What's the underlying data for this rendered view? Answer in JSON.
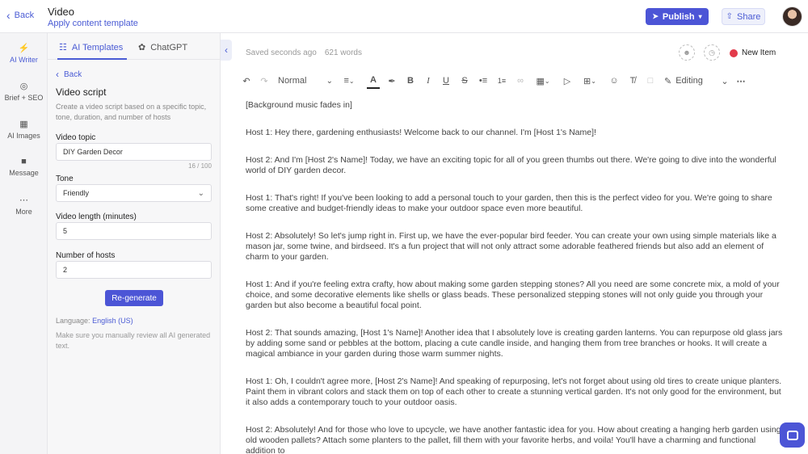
{
  "header": {
    "back_label": "Back",
    "title": "Video",
    "apply_template": "Apply content template",
    "publish_label": "Publish",
    "share_label": "Share"
  },
  "rail": {
    "items": [
      {
        "label": "AI Writer",
        "icon": "lightning-icon"
      },
      {
        "label": "Brief + SEO",
        "icon": "target-icon"
      },
      {
        "label": "AI Images",
        "icon": "image-icon"
      },
      {
        "label": "Message",
        "icon": "chat-icon"
      },
      {
        "label": "More",
        "icon": "more-icon"
      }
    ]
  },
  "panel": {
    "tabs": [
      {
        "label": "AI Templates"
      },
      {
        "label": "ChatGPT"
      }
    ],
    "back_label": "Back",
    "title": "Video script",
    "description": "Create a video script based on a specific topic, tone, duration, and number of hosts",
    "topic_label": "Video topic",
    "topic_value": "DIY Garden Decor",
    "topic_counter": "16 / 100",
    "tone_label": "Tone",
    "tone_value": "Friendly",
    "length_label": "Video length (minutes)",
    "length_value": "5",
    "hosts_label": "Number of hosts",
    "hosts_value": "2",
    "regenerate_label": "Re-generate",
    "language_prefix": "Language:",
    "language_value": "English (US)",
    "note": "Make sure you manually review all AI generated text."
  },
  "editor": {
    "saved": "Saved seconds ago",
    "words": "621 words",
    "status": "New Item",
    "status_color": "#e23a4a",
    "toolbar": {
      "style": "Normal",
      "mode": "Editing"
    },
    "paragraphs": [
      "[Background music fades in]",
      "Host 1: Hey there, gardening enthusiasts! Welcome back to our channel. I'm [Host 1's Name]!",
      "Host 2: And I'm [Host 2's Name]! Today, we have an exciting topic for all of you green thumbs out there. We're going to dive into the wonderful world of DIY garden decor.",
      "Host 1: That's right! If you've been looking to add a personal touch to your garden, then this is the perfect video for you. We're going to share some creative and budget-friendly ideas to make your outdoor space even more beautiful.",
      "Host 2: Absolutely! So let's jump right in. First up, we have the ever-popular bird feeder. You can create your own using simple materials like a mason jar, some twine, and birdseed. It's a fun project that will not only attract some adorable feathered friends but also add an element of charm to your garden.",
      "Host 1: And if you're feeling extra crafty, how about making some garden stepping stones? All you need are some concrete mix, a mold of your choice, and some decorative elements like shells or glass beads. These personalized stepping stones will not only guide you through your garden but also become a beautiful focal point.",
      "Host 2: That sounds amazing, [Host 1's Name]! Another idea that I absolutely love is creating garden lanterns. You can repurpose old glass jars by adding some sand or pebbles at the bottom, placing a cute candle inside, and hanging them from tree branches or hooks. It will create a magical ambiance in your garden during those warm summer nights.",
      "Host 1: Oh, I couldn't agree more, [Host 2's Name]! And speaking of repurposing, let's not forget about using old tires to create unique planters. Paint them in vibrant colors and stack them on top of each other to create a stunning vertical garden. It's not only good for the environment, but it also adds a contemporary touch to your outdoor oasis.",
      "Host 2: Absolutely! And for those who love to upcycle, we have another fantastic idea for you. How about creating a hanging herb garden using old wooden pallets? Attach some planters to the pallet, fill them with your favorite herbs, and voila! You'll have a charming and functional addition to"
    ]
  },
  "colors": {
    "accent": "#4c55d6",
    "link": "#4a5bd4"
  }
}
